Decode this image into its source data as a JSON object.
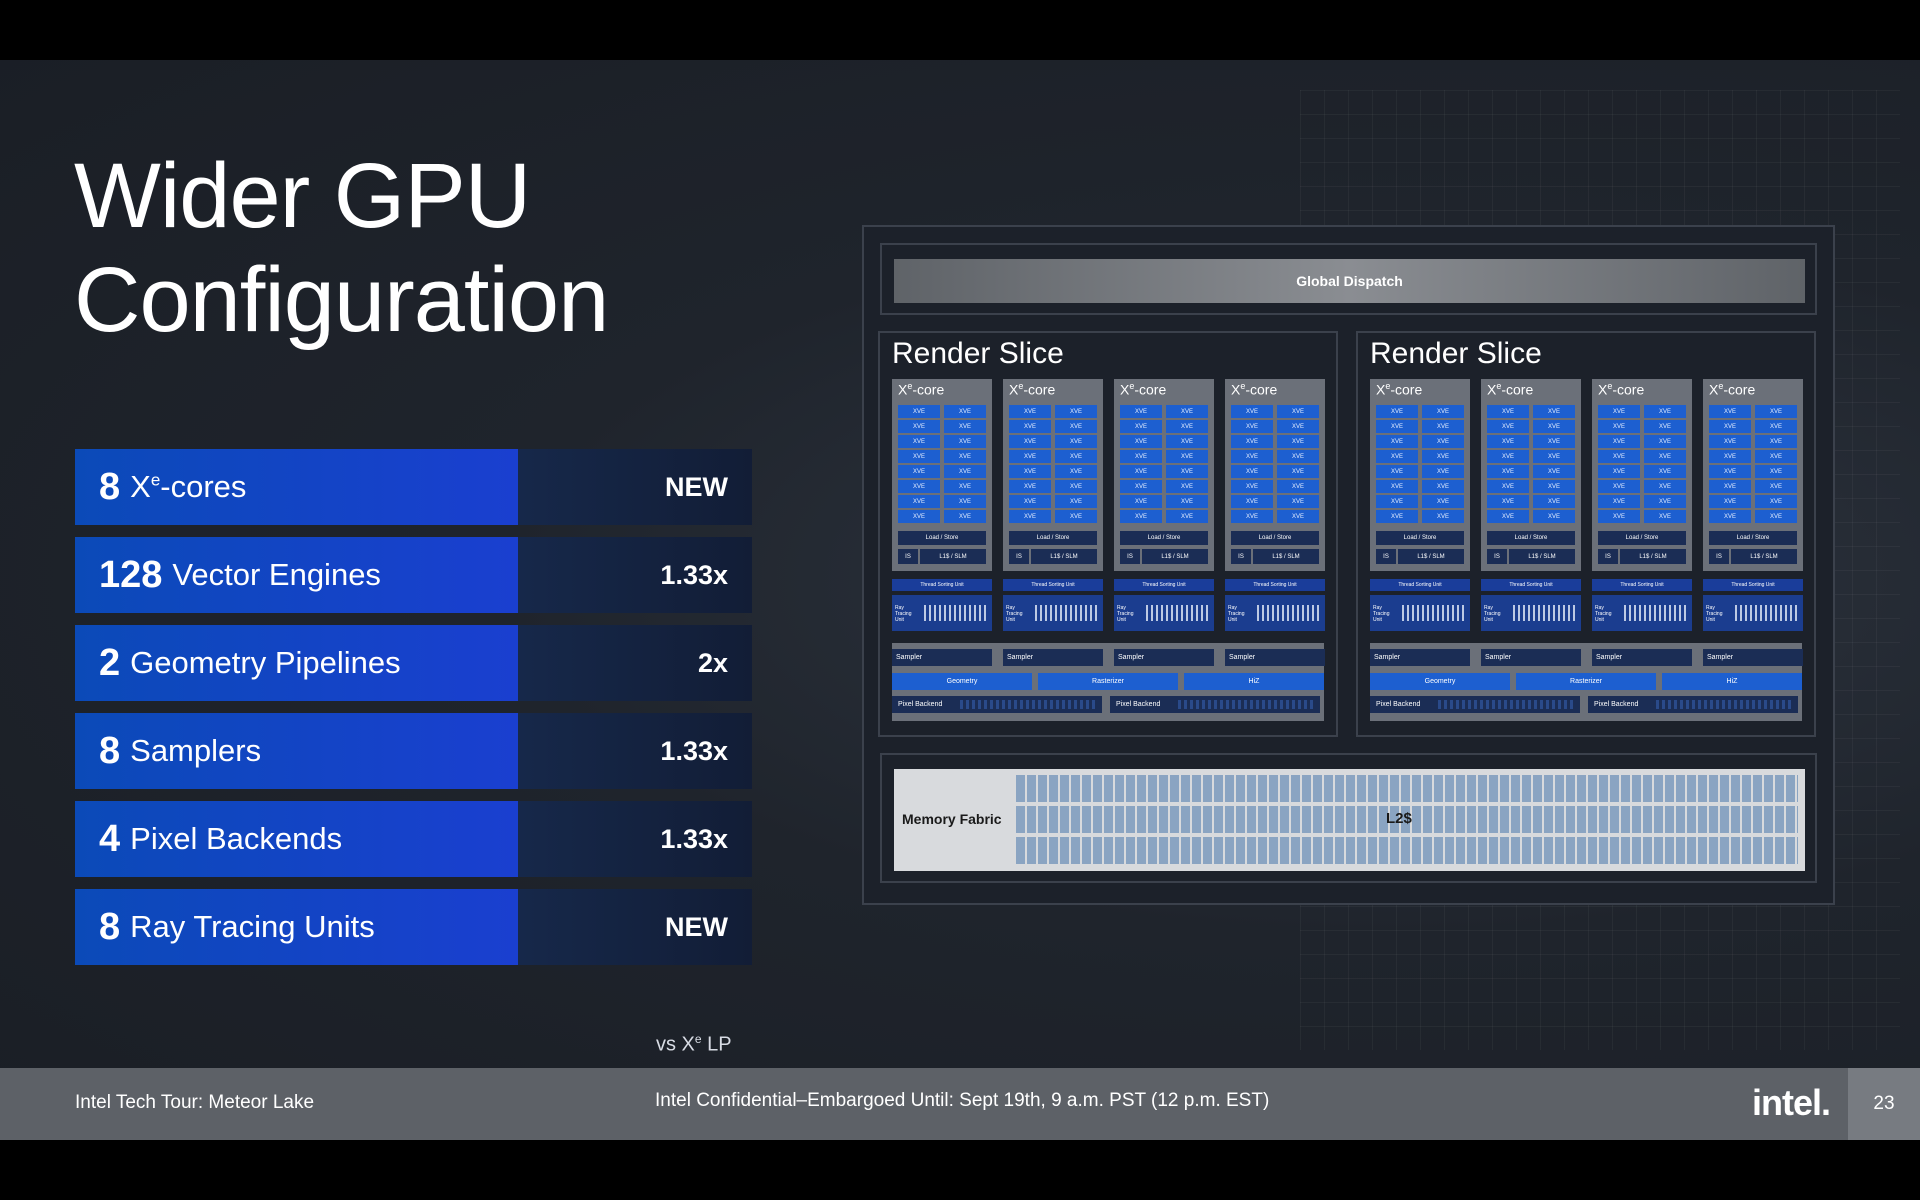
{
  "title": {
    "line1": "Wider GPU",
    "line2": "Configuration"
  },
  "specs": [
    {
      "num": "8",
      "label_main": "X",
      "label_sup": "e",
      "label_rest": "-cores",
      "delta": "NEW"
    },
    {
      "num": "128",
      "label_main": "Vector Engines",
      "label_sup": "",
      "label_rest": "",
      "delta": "1.33x"
    },
    {
      "num": "2",
      "label_main": "Geometry Pipelines",
      "label_sup": "",
      "label_rest": "",
      "delta": "2x"
    },
    {
      "num": "8",
      "label_main": "Samplers",
      "label_sup": "",
      "label_rest": "",
      "delta": "1.33x"
    },
    {
      "num": "4",
      "label_main": "Pixel Backends",
      "label_sup": "",
      "label_rest": "",
      "delta": "1.33x"
    },
    {
      "num": "8",
      "label_main": "Ray Tracing Units",
      "label_sup": "",
      "label_rest": "",
      "delta": "NEW"
    }
  ],
  "vs_note": {
    "prefix": "vs X",
    "sup": "e",
    "suffix": " LP"
  },
  "diagram": {
    "global_dispatch": "Global Dispatch",
    "slice_title": "Render Slice",
    "xe_core": {
      "main": "X",
      "sup": "e",
      "rest": "-core"
    },
    "xve": "XVE",
    "load_store": "Load / Store",
    "is": "IS",
    "l1_slm": "L1$ / SLM",
    "thread_sorting": "Thread Sorting Unit",
    "rtu": "Ray Tracing Unit",
    "sampler": "Sampler",
    "geometry": "Geometry",
    "rasterizer": "Rasterizer",
    "hiz": "HiZ",
    "pixel_backend": "Pixel Backend",
    "memory_fabric": "Memory Fabric",
    "l2": "L2$"
  },
  "footer": {
    "left": "Intel Tech Tour:  Meteor Lake",
    "center": "Intel Confidential–Embargoed Until: Sept 19th, 9 a.m. PST (12 p.m. EST)",
    "logo": "intel.",
    "page": "23"
  },
  "colors": {
    "spec_blue": "#1a3fd0",
    "xve_blue": "#1d5fd0",
    "footer_gray": "#5d6167"
  }
}
